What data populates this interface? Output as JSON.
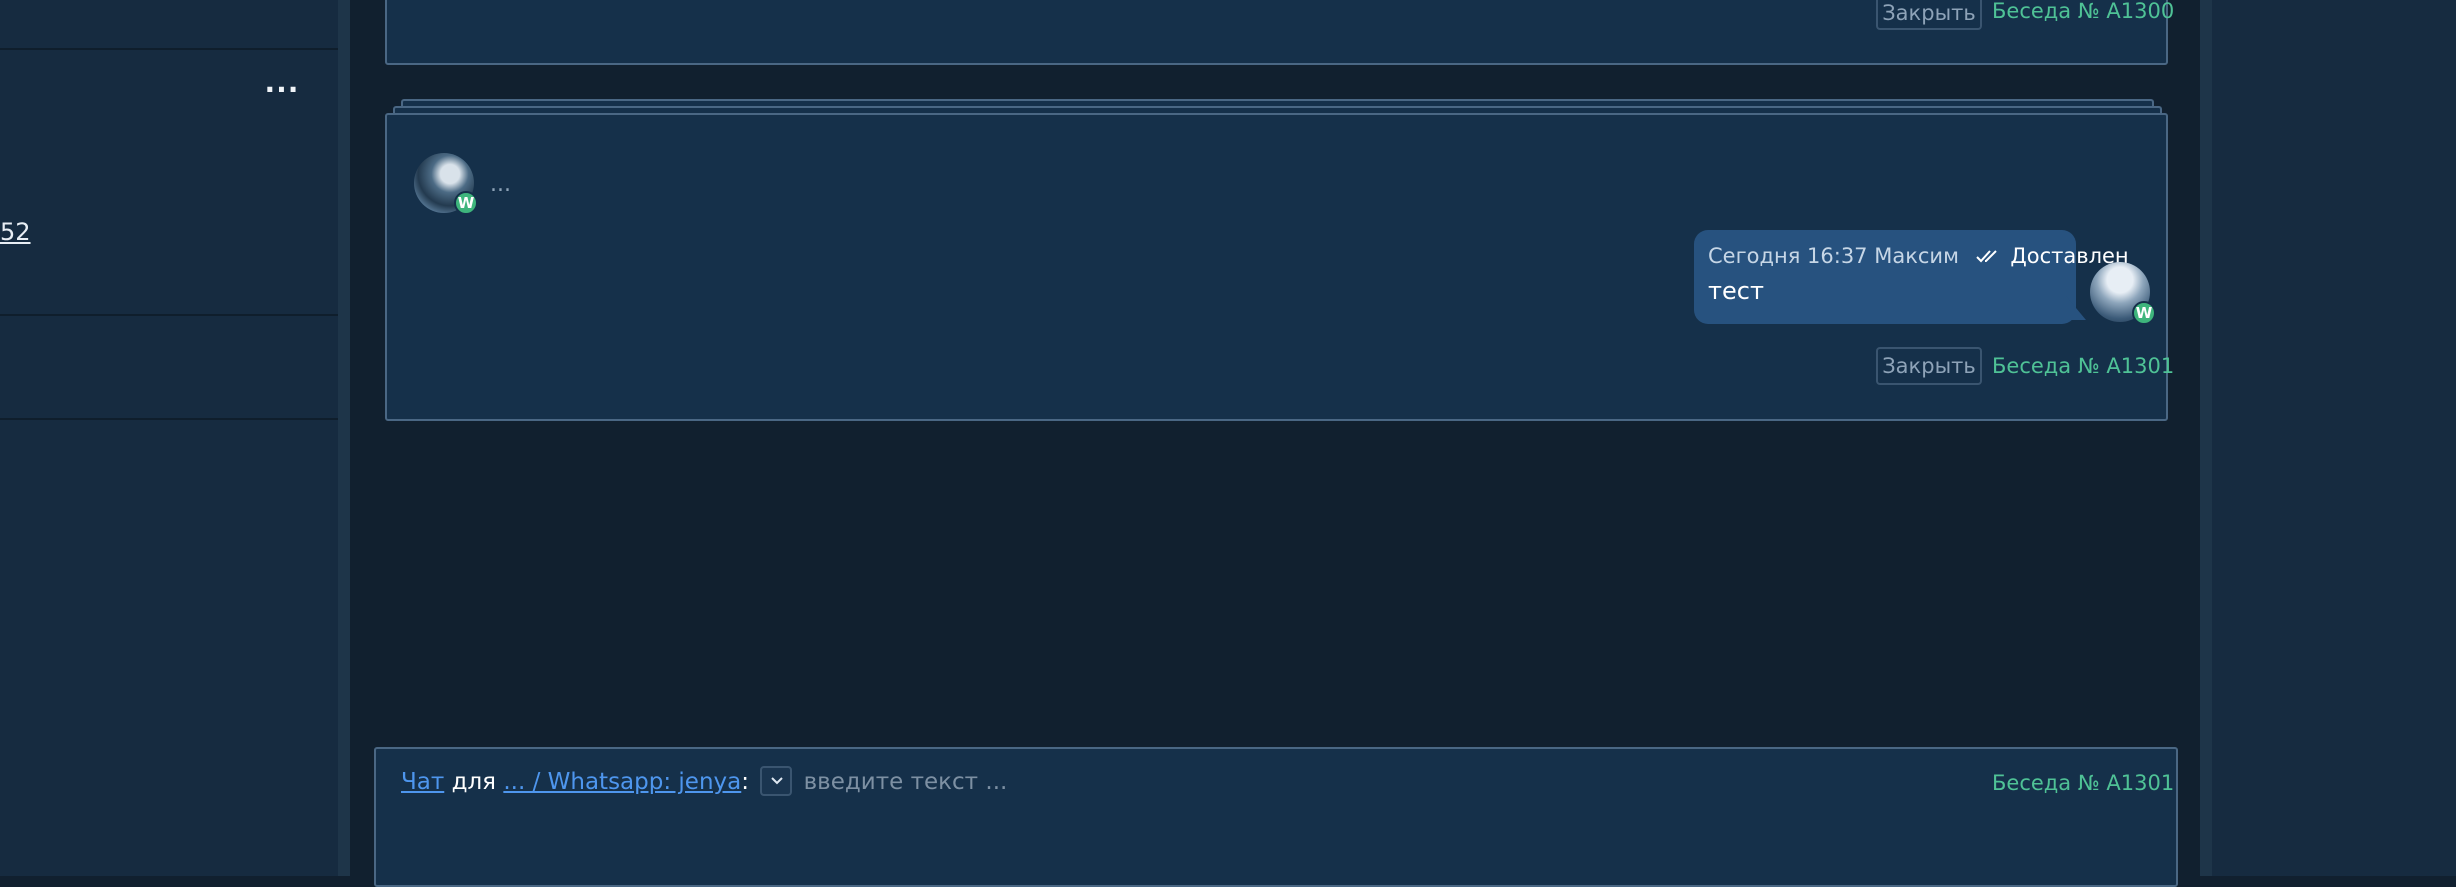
{
  "left_panel": {
    "more_label": "···",
    "link_text": "52"
  },
  "cards": [
    {
      "close_label": "Закрыть",
      "conversation_label": "Беседа № A1300"
    },
    {
      "typing_indicator": "...",
      "message": {
        "meta": "Сегодня 16:37 Максим",
        "status": "Доставлен",
        "text": "тест"
      },
      "close_label": "Закрыть",
      "conversation_label": "Беседа № A1301"
    }
  ],
  "composer": {
    "chat_link": "Чат",
    "for_text": "для",
    "target_link": "... / Whatsapp: jenya",
    "colon": ":",
    "placeholder": "введите текст ...",
    "conversation_label": "Беседа № A1301"
  },
  "badges": {
    "whatsapp_letter": "W"
  },
  "colors": {
    "background": "#11202f",
    "panel": "#15304a",
    "bubble": "#27527f",
    "accent_green": "#4fc296",
    "link_blue": "#4e96ee"
  }
}
